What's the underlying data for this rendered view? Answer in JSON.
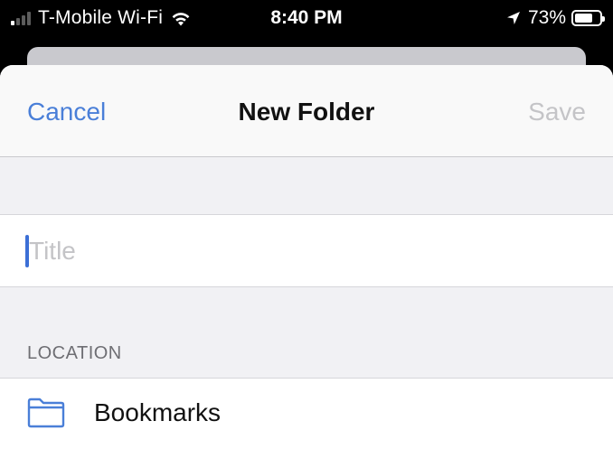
{
  "status_bar": {
    "carrier": "T-Mobile Wi-Fi",
    "time": "8:40 PM",
    "battery_percent": "73%",
    "battery_level": 0.73,
    "signal_bars_active": 1,
    "signal_bars_total": 4
  },
  "nav": {
    "cancel_label": "Cancel",
    "title": "New Folder",
    "save_label": "Save"
  },
  "form": {
    "title_placeholder": "Title",
    "title_value": ""
  },
  "location": {
    "section_header": "LOCATION",
    "folder_label": "Bookmarks",
    "folder_icon": "folder-icon"
  },
  "colors": {
    "accent": "#4a7fd8",
    "disabled": "#c4c4c7",
    "cursor": "#3c6fd6"
  }
}
